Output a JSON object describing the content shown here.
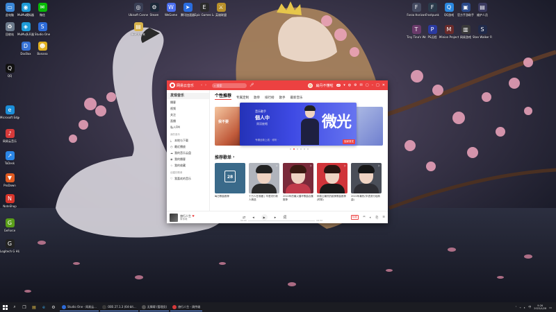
{
  "desktop": {
    "left_icons": [
      {
        "label": "此电脑",
        "color": "#3a86d6",
        "glyph": "▭"
      },
      {
        "label": "MuMu模拟器",
        "color": "#1e9bd7",
        "glyph": "◉"
      },
      {
        "label": "微信",
        "color": "#09bb07",
        "glyph": "✉"
      },
      {
        "label": "回收站",
        "color": "#6d7b8c",
        "glyph": "♻"
      },
      {
        "label": "MuMu多开器",
        "color": "#1e9bd7",
        "glyph": "◈"
      },
      {
        "label": "Studio One",
        "color": "#2d6bd8",
        "glyph": "S"
      },
      {
        "label": "DocBox",
        "color": "#3772d6",
        "glyph": "D"
      },
      {
        "label": "Banana",
        "color": "#e0b020",
        "glyph": "☻"
      },
      {
        "label": "QQ",
        "color": "#111111",
        "glyph": "Q"
      },
      {
        "label": "Microsoft Edge",
        "color": "#1b8ed8",
        "glyph": "e"
      },
      {
        "label": "网易云音乐",
        "color": "#d63a3a",
        "glyph": "♪"
      },
      {
        "label": "ToDesk",
        "color": "#2b86e6",
        "glyph": "↗"
      },
      {
        "label": "ProDown",
        "color": "#e05a20",
        "glyph": "▼"
      },
      {
        "label": "NoteShop",
        "color": "#d8342a",
        "glyph": "N"
      },
      {
        "label": "GeForce",
        "color": "#5a9e1a",
        "glyph": "G"
      },
      {
        "label": "Logitech G HUB",
        "color": "#222222",
        "glyph": "G"
      }
    ],
    "top_icons": [
      {
        "label": "Ubisoft Connect",
        "color": "#3a3f55",
        "glyph": "◎"
      },
      {
        "label": "Steam",
        "color": "#1b2838",
        "glyph": "⚙"
      },
      {
        "label": "WeGame",
        "color": "#4a6ef0",
        "glyph": "W"
      },
      {
        "label": "腾讯加速器",
        "color": "#2a6de0",
        "glyph": "➤"
      },
      {
        "label": "Epic Games Launcher",
        "color": "#2a2a2a",
        "glyph": "E"
      },
      {
        "label": "英雄联盟",
        "color": "#b8902a",
        "glyph": "⚔"
      }
    ],
    "right_icons": [
      {
        "label": "Forza Horizon",
        "color": "#444a60",
        "glyph": "F"
      },
      {
        "label": "Frostpunk",
        "color": "#2a3a4a",
        "glyph": "F"
      },
      {
        "label": "QQ游戏",
        "color": "#2a88e0",
        "glyph": "Q"
      },
      {
        "label": "官方手游助手",
        "color": "#2a4a8a",
        "glyph": "▣"
      },
      {
        "label": "维护人员",
        "color": "#3a3a60",
        "glyph": "▤"
      },
      {
        "label": "Tiny Tina's Wonderl...",
        "color": "#6a3a6a",
        "glyph": "T"
      },
      {
        "label": "PS远程",
        "color": "#2a3aa0",
        "glyph": "P"
      },
      {
        "label": "Minion Project",
        "color": "#6a2a2a",
        "glyph": "M"
      },
      {
        "label": "网易游戏",
        "color": "#3a3a3a",
        "glyph": "▥"
      },
      {
        "label": "Stan Walker Remastered",
        "color": "#202a4a",
        "glyph": "S"
      }
    ],
    "single_icon": {
      "label": "新建文件夹",
      "color": "#d7b24a",
      "glyph": "▤"
    }
  },
  "window": {
    "app_name": "网易云音乐",
    "search_placeholder": "搜索",
    "user_name": "扁丹不懂啦",
    "vip_badge": "VIP",
    "sidebar": {
      "items": [
        {
          "label": "发现音乐",
          "active": true
        },
        {
          "label": "播客"
        },
        {
          "label": "视频"
        },
        {
          "label": "关注"
        },
        {
          "label": "直播"
        },
        {
          "label": "私人FM"
        }
      ],
      "my_music_header": "我的音乐",
      "my_music": [
        {
          "label": "本地与下载",
          "icon": "⤓"
        },
        {
          "label": "最近播放",
          "icon": "◷"
        },
        {
          "label": "我的音乐云盘",
          "icon": "☁"
        },
        {
          "label": "我的播客",
          "icon": "◉"
        },
        {
          "label": "我的收藏",
          "icon": "☆"
        }
      ],
      "created_header": "创建的歌单",
      "created": [
        {
          "label": "我喜欢的音乐",
          "icon": "♡"
        }
      ]
    },
    "tabs": [
      "个性推荐",
      "专属定制",
      "歌单",
      "排行榜",
      "歌手",
      "最新音乐"
    ],
    "banner": {
      "side_left_text": "我不要",
      "small_line": "音乐歌手",
      "title_line": "個人中",
      "sub_line": "周深被唱",
      "big_text": "微光",
      "footer": "专辑全新上线 · 倾听 ·",
      "tag": "独家首发"
    },
    "recommend_title": "推荐歌单",
    "playlists": [
      {
        "caption": "每日歌曲推荐",
        "type": "calendar",
        "color": "#3a6a8a",
        "calendar_day": "28"
      },
      {
        "caption": "十万人在收藏 | 华语流行新人精选",
        "type": "face",
        "color": "#b0b4bc",
        "hair": "#222",
        "body": "#2a2a2a"
      },
      {
        "caption": "2022年的最火循环歌曲合集推荐",
        "type": "face",
        "color": "#7a2a3a",
        "hair": "#3a1a12",
        "body": "#c03a4a"
      },
      {
        "caption": "网易云最热的欧美歌曲推荐(附带)",
        "type": "face",
        "color": "#d0343a",
        "hair": "#2a1410",
        "body": "#1a1a1a"
      },
      {
        "caption": "2022年最热(华语流行经典曲)",
        "type": "face",
        "color": "#4a4e58",
        "hair": "#161616",
        "body": "#2e2e34"
      }
    ],
    "player": {
      "title": "旅行人生",
      "artist": "周传雄",
      "time_current": "00:00",
      "time_total": "04:32",
      "progress": 0.0,
      "quality": "标准"
    }
  },
  "taskbar": {
    "apps": [
      {
        "label": "Studio One - 网易云...",
        "color": "#2d6bd8"
      },
      {
        "label": "OBS 27.1.3 (64-bit...",
        "color": "#3a3a3a"
      },
      {
        "label": "无障碍 (管理员)",
        "color": "#555555"
      },
      {
        "label": "旅行人生 - 周传雄",
        "color": "#d63a3a"
      }
    ],
    "clock_time": "9:26",
    "clock_date": "2022/4/28"
  }
}
